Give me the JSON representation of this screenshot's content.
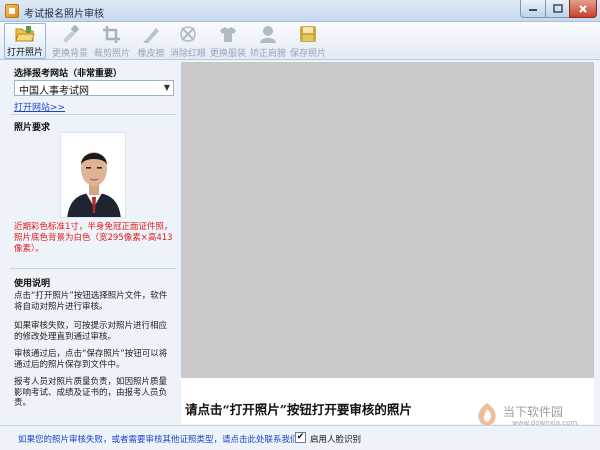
{
  "window": {
    "title": "考试报名照片审核"
  },
  "toolbar": {
    "items": [
      {
        "label": "打开照片",
        "icon": "folder-open-icon",
        "enabled": true
      },
      {
        "label": "更换背景",
        "icon": "brush-icon",
        "enabled": false
      },
      {
        "label": "裁剪照片",
        "icon": "crop-icon",
        "enabled": false
      },
      {
        "label": "橡皮擦",
        "icon": "eraser-pen-icon",
        "enabled": false
      },
      {
        "label": "消除红眼",
        "icon": "red-eye-icon",
        "enabled": false
      },
      {
        "label": "更换服装",
        "icon": "clothes-icon",
        "enabled": false
      },
      {
        "label": "矫正肩膀",
        "icon": "shoulder-icon",
        "enabled": false
      },
      {
        "label": "保存照片",
        "icon": "save-disk-icon",
        "enabled": false
      }
    ]
  },
  "left_panel": {
    "site_section": {
      "title": "选择报考网站（非常重要）",
      "selected_site": "中国人事考试网",
      "open_link": "打开网站>>"
    },
    "photo_section": {
      "title": "照片要求",
      "requirement": "近期彩色标准1寸，半身免冠正面证件照，照片底色背景为白色（宽295像素×高413像素）。"
    },
    "help_section": {
      "title": "使用说明",
      "paragraphs": [
        "点击“打开照片”按钮选择照片文件，软件将自动对照片进行审核。",
        "如果审核失败，可按提示对照片进行相应的修改处理直到通过审核。",
        "审核通过后，点击“保存照片”按钮可以将通过后的照片保存到文件中。",
        "报考人员对照片质量负责，如因照片质量影响考试、成绩及证书的，由报考人员负责。"
      ]
    }
  },
  "main": {
    "hint": "请点击“打开照片”按钮打开要审核的照片"
  },
  "status_bar": {
    "help_link": "如果您的照片审核失败，或者需要审核其他证照类型，请点击此处联系我们",
    "face_recognition_label": "启用人脸识别",
    "face_recognition_checked": true
  },
  "watermark": {
    "text": "当下软件园",
    "url": "www.downxia.com"
  },
  "colors": {
    "requirement_text": "#e01c1c",
    "link": "#1a43c9",
    "preview_bg": "#c9c9c9"
  }
}
